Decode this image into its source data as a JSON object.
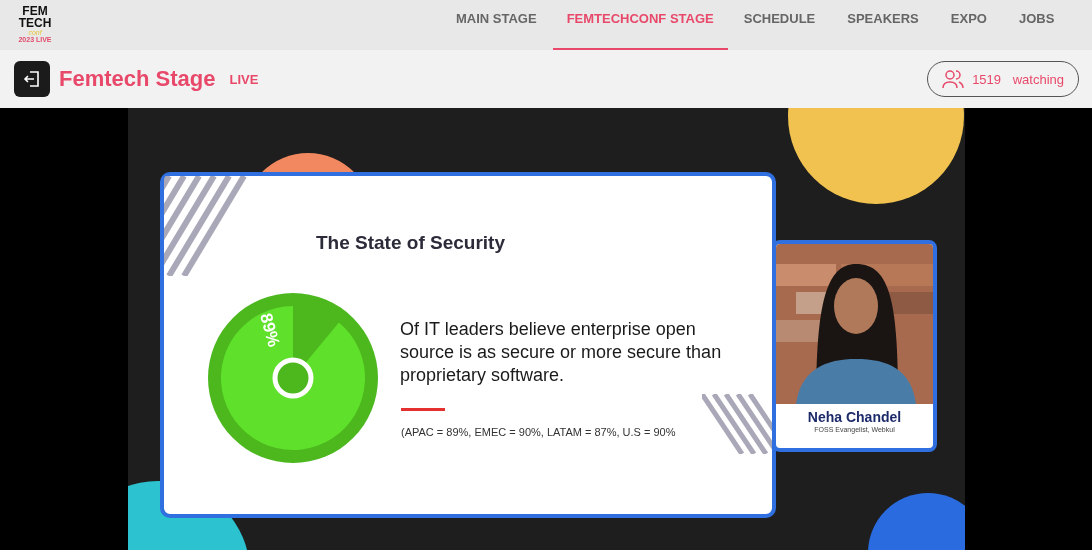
{
  "logo": {
    "lines": [
      "FEM",
      "TECH"
    ],
    "sub": "conf",
    "year": "2023 LIVE"
  },
  "nav": [
    {
      "label": "MAIN STAGE",
      "selected": false
    },
    {
      "label": "FEMTECHCONF STAGE",
      "selected": true
    },
    {
      "label": "SCHEDULE",
      "selected": false
    },
    {
      "label": "SPEAKERS",
      "selected": false
    },
    {
      "label": "EXPO",
      "selected": false
    },
    {
      "label": "JOBS",
      "selected": false
    }
  ],
  "stage": {
    "title": "Femtech Stage",
    "badge": "LIVE",
    "viewers": "1519",
    "viewers_label": "watching"
  },
  "slide": {
    "title": "The State of Security",
    "percent": "89%",
    "statement": "Of IT leaders believe enterprise open source is as secure or more secure than proprietary software.",
    "note": "(APAC = 89%, EMEC = 90%, LATAM = 87%, U.S = 90%"
  },
  "speaker": {
    "name": "Neha Chandel",
    "role": "FOSS Evangelist, Webkul"
  }
}
